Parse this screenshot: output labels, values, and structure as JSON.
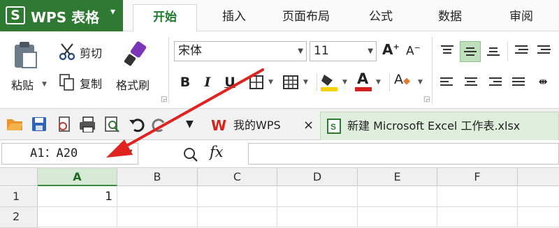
{
  "app": {
    "logo": "S",
    "title": "WPS 表格",
    "menu_caret": "▾",
    "brand_color": "#2e7a32"
  },
  "tabs": [
    {
      "label": "开始",
      "active": true
    },
    {
      "label": "插入",
      "active": false
    },
    {
      "label": "页面布局",
      "active": false
    },
    {
      "label": "公式",
      "active": false
    },
    {
      "label": "数据",
      "active": false
    },
    {
      "label": "审阅",
      "active": false
    }
  ],
  "ribbon": {
    "clipboard": {
      "paste_label": "粘贴",
      "cut_label": "剪切",
      "copy_label": "复制",
      "format_painter_label": "格式刷"
    },
    "font": {
      "name": "宋体",
      "size": "11",
      "grow": "A",
      "shrink": "A",
      "bold": "B",
      "italic": "I",
      "underline": "U",
      "font_color_letter": "A",
      "font_color": "#d32020",
      "fill_color": "#f5d100"
    }
  },
  "quickbar": {
    "doc_tabs": [
      {
        "label": "我的WPS",
        "close": "×"
      },
      {
        "label": "新建 Microsoft Excel 工作表.xlsx",
        "close": ""
      }
    ]
  },
  "formula_bar": {
    "name_box": "A1：A20",
    "fx_label": "fx",
    "formula": ""
  },
  "grid": {
    "columns": [
      "A",
      "B",
      "C",
      "D",
      "E",
      "F"
    ],
    "selected_column": "A",
    "rows": [
      {
        "header": "1",
        "cells": [
          "1",
          "",
          "",
          "",
          "",
          ""
        ]
      },
      {
        "header": "2",
        "cells": [
          "",
          "",
          "",
          "",
          "",
          ""
        ]
      }
    ]
  },
  "annotation": {
    "color": "#e0231f"
  }
}
